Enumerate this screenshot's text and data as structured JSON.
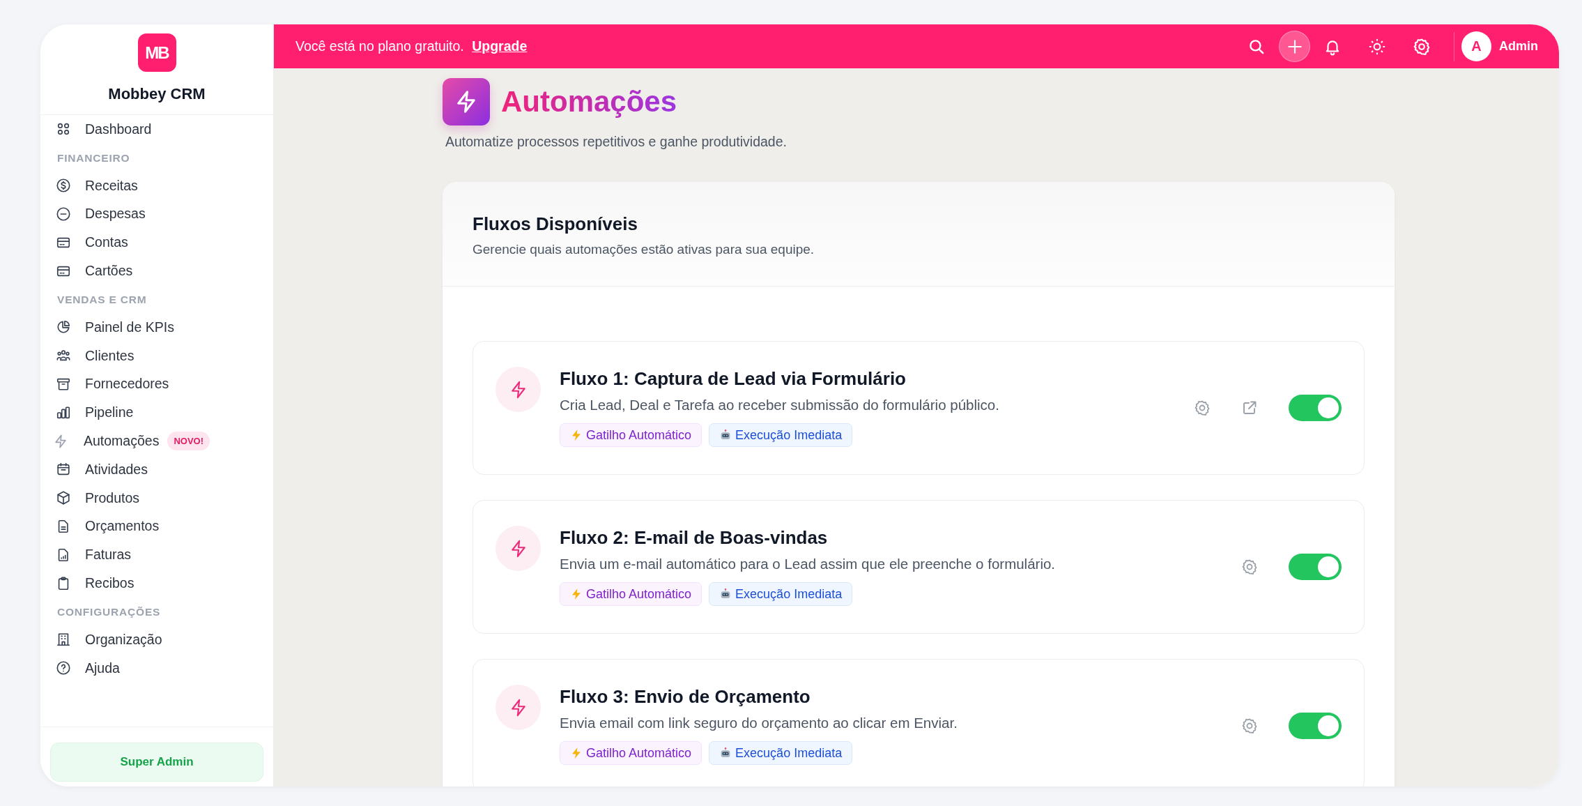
{
  "sidebar": {
    "logo_text": "MB",
    "brand": "Mobbey CRM",
    "sections": [
      {
        "items": [
          {
            "label": "Dashboard"
          }
        ]
      },
      {
        "heading": "FINANCEIRO",
        "items": [
          {
            "label": "Receitas"
          },
          {
            "label": "Despesas"
          },
          {
            "label": "Contas"
          },
          {
            "label": "Cartões"
          }
        ]
      },
      {
        "heading": "VENDAS E CRM",
        "items": [
          {
            "label": "Painel de KPIs"
          },
          {
            "label": "Clientes"
          },
          {
            "label": "Fornecedores"
          },
          {
            "label": "Pipeline"
          },
          {
            "label": "Automações",
            "badge": "NOVO!"
          },
          {
            "label": "Atividades"
          },
          {
            "label": "Produtos"
          },
          {
            "label": "Orçamentos"
          },
          {
            "label": "Faturas"
          },
          {
            "label": "Recibos"
          }
        ]
      },
      {
        "heading": "CONFIGURAÇÕES",
        "items": [
          {
            "label": "Organização"
          },
          {
            "label": "Ajuda"
          }
        ]
      }
    ],
    "footer_button": "Super Admin"
  },
  "topbar": {
    "plan_notice": "Você está no plano gratuito.",
    "upgrade_link": "Upgrade",
    "avatar_initial": "A",
    "user_name": "Admin"
  },
  "page": {
    "title": "Automações",
    "subtitle": "Automatize processos repetitivos e ganhe produtividade."
  },
  "panel": {
    "title": "Fluxos Disponíveis",
    "subtitle": "Gerencie quais automações estão ativas para sua equipe.",
    "flows": [
      {
        "title": "Fluxo 1: Captura de Lead via Formulário",
        "description": "Cria Lead, Deal e Tarefa ao receber submissão do formulário público.",
        "external_link": true,
        "on": true,
        "tags": [
          {
            "kind": "trigger",
            "label": "Gatilho Automático"
          },
          {
            "kind": "execution",
            "label": "Execução Imediata"
          }
        ]
      },
      {
        "title": "Fluxo 2: E-mail de Boas-vindas",
        "description": "Envia um e-mail automático para o Lead assim que ele preenche o formulário.",
        "external_link": false,
        "on": true,
        "tags": [
          {
            "kind": "trigger",
            "label": "Gatilho Automático"
          },
          {
            "kind": "execution",
            "label": "Execução Imediata"
          }
        ]
      },
      {
        "title": "Fluxo 3: Envio de Orçamento",
        "description": "Envia email com link seguro do orçamento ao clicar em Enviar.",
        "external_link": false,
        "on": true,
        "tags": [
          {
            "kind": "trigger",
            "label": "Gatilho Automático"
          },
          {
            "kind": "execution",
            "label": "Execução Imediata"
          }
        ]
      }
    ]
  }
}
